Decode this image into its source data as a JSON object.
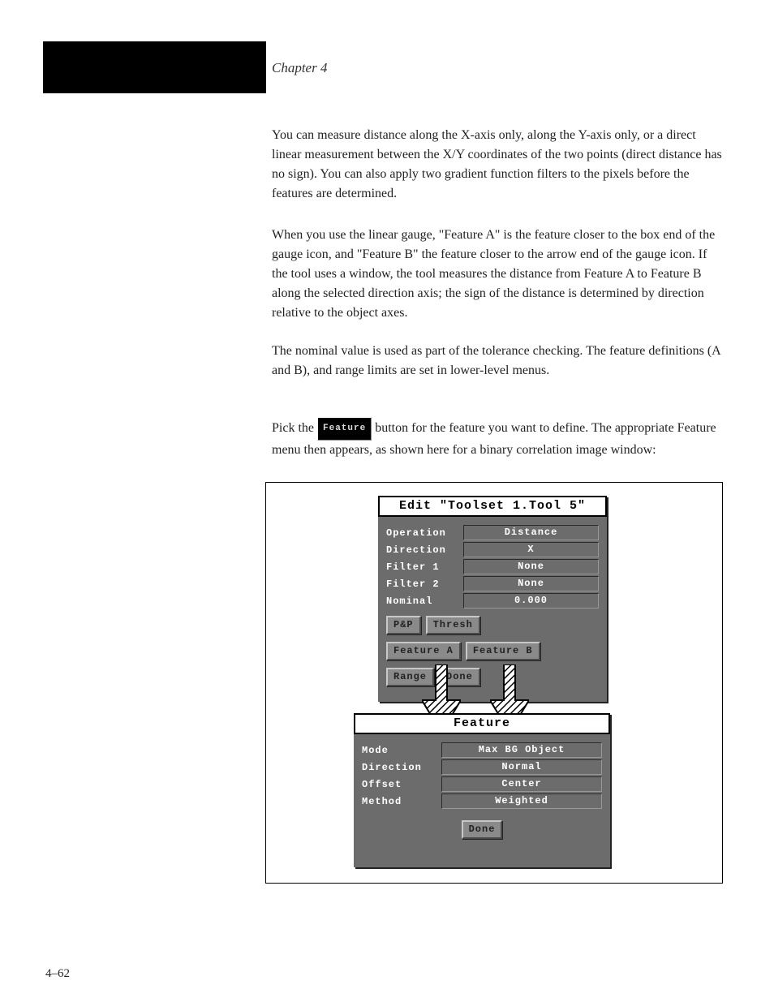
{
  "chapter": "Chapter 4",
  "page_number": "4–62",
  "paragraphs": {
    "p1": "You can measure distance along the X-axis only, along the Y-axis only, or a direct linear measurement between the X/Y coordinates of the two points (direct distance has no sign). You can also apply two gradient function filters to the pixels before the features are determined.",
    "p2": "When you use the linear gauge, \"Feature A\" is the feature closer to the box end of the gauge icon, and \"Feature B\" the feature closer to the arrow end of the gauge icon. If the tool uses a window, the tool measures the distance from Feature A to Feature B along the selected direction axis; the sign of the distance is determined by direction relative to the object axes.",
    "p3": "The nominal value is used as part of the tolerance checking. The feature definitions (A and B), and range limits are set in lower-level menus.",
    "p4_a": "Pick the ",
    "p4_b": " button for the feature you want to define. The appropriate Feature menu then appears, as shown here for a binary correlation image window:"
  },
  "inline_button": "Feature",
  "panel1": {
    "title": "Edit \"Toolset 1.Tool 5\"",
    "rows": [
      {
        "label": "Operation",
        "value": "Distance"
      },
      {
        "label": "Direction",
        "value": "X"
      },
      {
        "label": "Filter 1",
        "value": "None"
      },
      {
        "label": "Filter 2",
        "value": "None"
      },
      {
        "label": "Nominal",
        "value": "0.000"
      }
    ],
    "buttons": [
      "P&P",
      "Thresh",
      "Feature A",
      "Feature B",
      "Range",
      "Done"
    ]
  },
  "panel2": {
    "title": "Feature",
    "rows": [
      {
        "label": "Mode",
        "value": "Max BG Object"
      },
      {
        "label": "Direction",
        "value": "Normal"
      },
      {
        "label": "Offset",
        "value": "Center"
      },
      {
        "label": "Method",
        "value": "Weighted"
      }
    ],
    "done": "Done"
  }
}
